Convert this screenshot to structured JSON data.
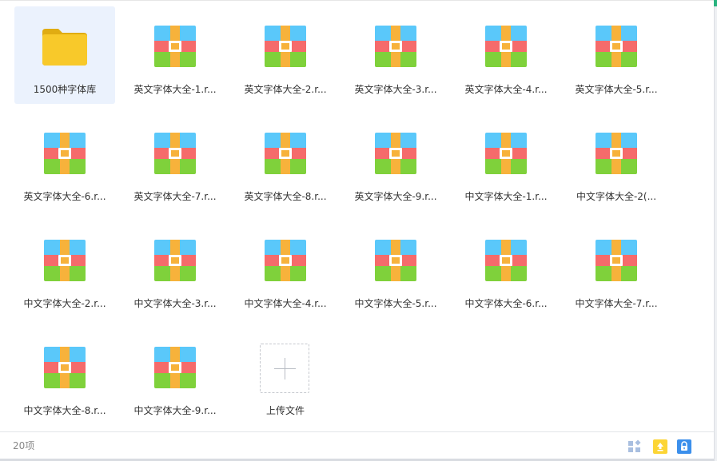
{
  "items": [
    {
      "label": "1500种字体库",
      "type": "folder",
      "selected": true
    },
    {
      "label": "英文字体大全-1.r...",
      "type": "archive"
    },
    {
      "label": "英文字体大全-2.r...",
      "type": "archive"
    },
    {
      "label": "英文字体大全-3.r...",
      "type": "archive"
    },
    {
      "label": "英文字体大全-4.r...",
      "type": "archive"
    },
    {
      "label": "英文字体大全-5.r...",
      "type": "archive"
    },
    {
      "label": "英文字体大全-6.r...",
      "type": "archive"
    },
    {
      "label": "英文字体大全-7.r...",
      "type": "archive"
    },
    {
      "label": "英文字体大全-8.r...",
      "type": "archive"
    },
    {
      "label": "英文字体大全-9.r...",
      "type": "archive"
    },
    {
      "label": "中文字体大全-1.r...",
      "type": "archive"
    },
    {
      "label": "中文字体大全-2(...",
      "type": "archive"
    },
    {
      "label": "中文字体大全-2.r...",
      "type": "archive"
    },
    {
      "label": "中文字体大全-3.r...",
      "type": "archive"
    },
    {
      "label": "中文字体大全-4.r...",
      "type": "archive"
    },
    {
      "label": "中文字体大全-5.r...",
      "type": "archive"
    },
    {
      "label": "中文字体大全-6.r...",
      "type": "archive"
    },
    {
      "label": "中文字体大全-7.r...",
      "type": "archive"
    },
    {
      "label": "中文字体大全-8.r...",
      "type": "archive"
    },
    {
      "label": "中文字体大全-9.r...",
      "type": "archive"
    }
  ],
  "upload": {
    "label": "上传文件",
    "icon": "plus-icon"
  },
  "footer": {
    "count": "20项",
    "icons": [
      "grid-view-icon",
      "upload-icon",
      "lock-icon"
    ]
  },
  "colors": {
    "selected_bg": "#ebf2fd",
    "folder": "#f8c92a",
    "archive_top": "#5ac8fa",
    "archive_mid": "#f56b6b",
    "archive_bottom": "#7fd13b",
    "archive_band": "#f7b23b",
    "upload_btn": "#fcd535",
    "lock_btn": "#3b8fec"
  }
}
